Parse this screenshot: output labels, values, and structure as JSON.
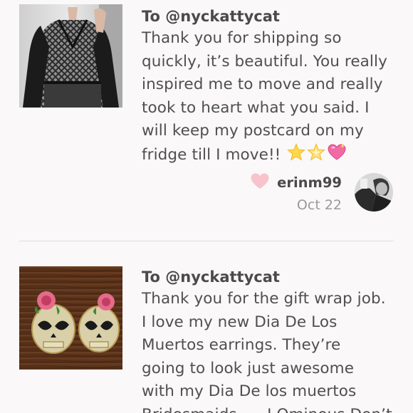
{
  "notes": [
    {
      "to": "To @nyckattycat",
      "message_lines": [
        "Thank you for shipping so",
        "quickly, it’s beautiful. You really",
        "inspired me to move and really",
        "took to heart what you said. I",
        "will keep my postcard on my",
        "fridge till I move!!"
      ],
      "emojis": [
        "star-icon",
        "sparkle-star-icon",
        "sparkling-heart-icon"
      ],
      "username": "erinm99",
      "date": "Oct 22",
      "heart_color": "#f7c3cc",
      "thumbnail": "black-mesh-top-photo"
    },
    {
      "to": "To @nyckattycat",
      "message_lines": [
        "Thank you for the gift wrap job.",
        "I love my new Dia De Los",
        "Muertos earrings. They’re",
        "going to look just awesome",
        "with my Dia De los muertos",
        "Bridesmaids …. I Ominous Don’t"
      ],
      "thumbnail": "skull-earrings-photo"
    }
  ],
  "colors": {
    "background": "#faf8f8",
    "text": "#4a4a4a",
    "muted": "#9a9a9a",
    "divider": "#e1dede"
  }
}
